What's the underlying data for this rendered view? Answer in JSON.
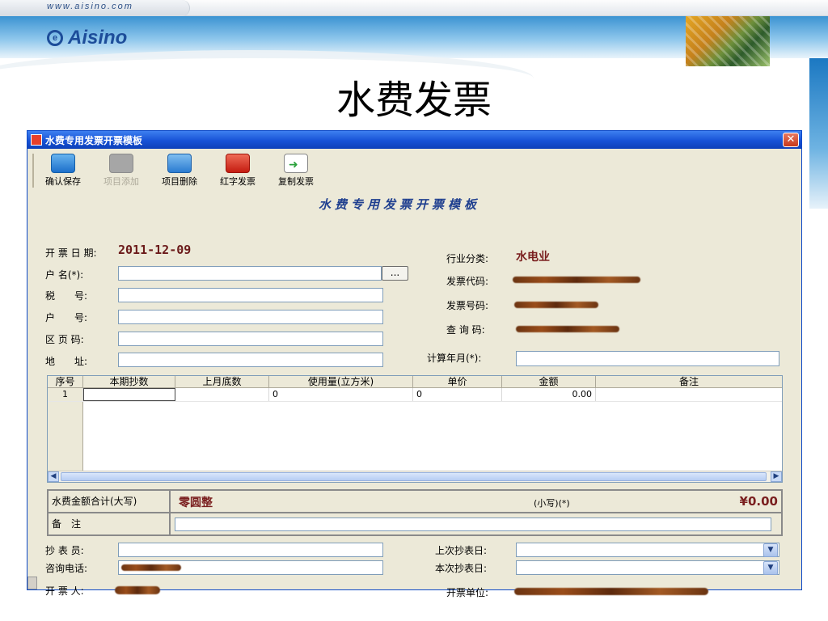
{
  "banner": {
    "url": "www.aisino.com",
    "logo": "Aisino"
  },
  "slide_title": "水费发票",
  "window": {
    "title": "水费专用发票开票模板",
    "close_icon": "close-icon"
  },
  "toolbar": {
    "save": "确认保存",
    "add_item": "项目添加",
    "delete_item": "项目删除",
    "red_invoice": "红字发票",
    "copy_invoice": "复制发票"
  },
  "form_title": "水费专用发票开票模板",
  "left_fields": {
    "date_label": "开 票 日 期:",
    "date_value": "2011-12-09",
    "account_name": "户 名(*):",
    "tax_no": "税　　号:",
    "account_no": "户　　号:",
    "page_code": "区 页 码:",
    "address": "地　　址:"
  },
  "right_fields": {
    "industry_label": "行业分类:",
    "industry_value": "水电业",
    "invoice_code": "发票代码:",
    "invoice_number": "发票号码:",
    "query_code": "查 询 码:",
    "billing_month": "计算年月(*):"
  },
  "grid": {
    "columns": [
      "序号",
      "本期抄数",
      "上月底数",
      "使用量(立方米)",
      "单价",
      "金额",
      "备注"
    ],
    "rows": [
      {
        "no": "1",
        "current": "",
        "previous": "",
        "usage": "0",
        "price": "0",
        "amount": "0.00",
        "remark": ""
      }
    ]
  },
  "totals": {
    "caps_label": "水费金额合计(大写)",
    "caps_value": "零圆整",
    "small_label": "(小写)(*)",
    "small_value": "¥0.00",
    "remarks_label": "备　注"
  },
  "bottom": {
    "reader": "抄 表 员:",
    "hotline": "咨询电话:",
    "issuer": "开 票 人:",
    "last_read": "上次抄表日:",
    "this_read": "本次抄表日:",
    "issuer_unit": "开票单位:"
  }
}
